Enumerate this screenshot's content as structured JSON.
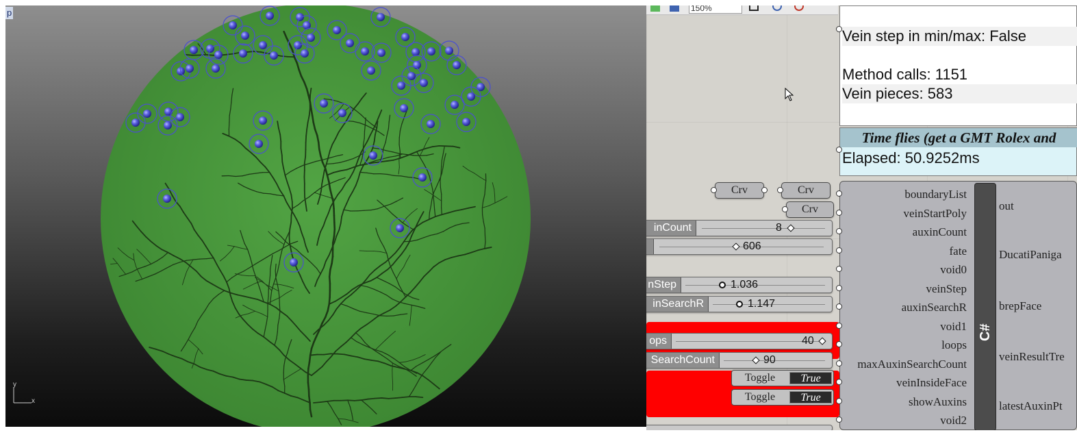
{
  "viewport": {
    "label": "p",
    "axis_x": "x",
    "axis_y": "y",
    "colors": {
      "leaf": "#4b9a3e",
      "vein": "#1d3a16",
      "auxin": "#4a4fd0"
    }
  },
  "toolbar": {
    "zoom": "150%"
  },
  "panel_stats": {
    "line1": "Vein step in min/max: False",
    "line2": "Method calls: 1151",
    "line3": "Vein pieces: 583"
  },
  "panel_timer": {
    "title": "Time flies (get a GMT Rolex and",
    "elapsed": "Elapsed: 50.9252ms"
  },
  "params": {
    "crv1": "Crv",
    "crv2": "Crv",
    "crv3": "Crv"
  },
  "sliders": [
    {
      "label": "inCount",
      "value": "8"
    },
    {
      "label": "",
      "value": "606"
    },
    {
      "label": "nStep",
      "value": "1.036"
    },
    {
      "label": "inSearchR",
      "value": "1.147"
    },
    {
      "label": "ops",
      "value": "40"
    },
    {
      "label": "SearchCount",
      "value": "90"
    }
  ],
  "toggles": [
    {
      "label": "Toggle",
      "value": "True"
    },
    {
      "label": "Toggle",
      "value": "True"
    }
  ],
  "component": {
    "title": "C#",
    "inputs": [
      "boundaryList",
      "veinStartPoly",
      "auxinCount",
      "fate",
      "void0",
      "veinStep",
      "auxinSearchR",
      "void1",
      "loops",
      "maxAuxinSearchCount",
      "veinInsideFace",
      "showAuxins",
      "void2"
    ],
    "outputs": [
      "out",
      "DucatiPaniga",
      "brepFace",
      "veinResultTre",
      "latestAuxinPt"
    ]
  }
}
